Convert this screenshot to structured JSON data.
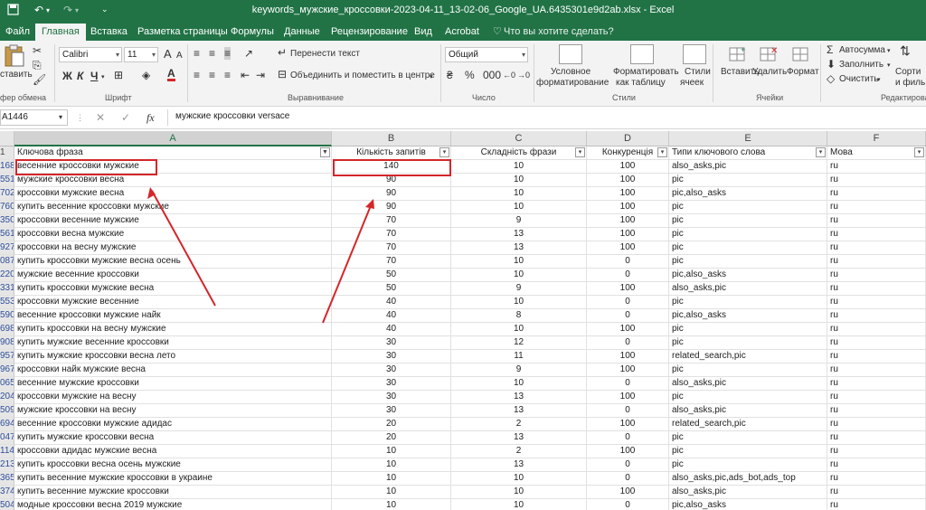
{
  "window": {
    "title": "keywords_мужские_кроссовки-2023-04-11_13-02-06_Google_UA.6435301e9d2ab.xlsx - Excel"
  },
  "tabs": [
    "Файл",
    "Главная",
    "Вставка",
    "Разметка страницы",
    "Формулы",
    "Данные",
    "Рецензирование",
    "Вид",
    "Acrobat",
    "Что вы хотите сделать?"
  ],
  "active_tab": "Главная",
  "ribbon": {
    "paste_label": "ставить",
    "clipboard_label": "фер обмена",
    "font_name": "Calibri",
    "font_size": "11",
    "bold": "Ж",
    "italic": "К",
    "underline": "Ч",
    "grow_font": "A",
    "shrink_font": "A",
    "font_color_letter": "A",
    "font_group_label": "Шрифт",
    "wrap_text": "Перенести текст",
    "merge_center": "Объединить и поместить в центре",
    "alignment_group_label": "Выравнивание",
    "number_format": "Общий",
    "number_group_label": "Число",
    "conditional_fmt_1": "Условное",
    "conditional_fmt_2": "форматирование",
    "format_table_1": "Форматировать",
    "format_table_2": "как таблицу",
    "cell_styles_1": "Стили",
    "cell_styles_2": "ячеек",
    "styles_group_label": "Стили",
    "insert": "Вставить",
    "delete": "Удалить",
    "format": "Формат",
    "cells_group_label": "Ячейки",
    "autosum": "Автосумма",
    "fill": "Заполнить",
    "clear": "Очистить",
    "sort_1": "Сорти",
    "sort_2": "и филь",
    "editing_group_label": "Редактирова"
  },
  "formula_bar": {
    "name_box": "A1446",
    "fx": "fx",
    "cancel": "✕",
    "enter": "✓",
    "content": "мужские кроссовки versace"
  },
  "columns": [
    {
      "letter": "A",
      "selected": true
    },
    {
      "letter": "B",
      "selected": false
    },
    {
      "letter": "C",
      "selected": false
    },
    {
      "letter": "D",
      "selected": false
    },
    {
      "letter": "E",
      "selected": false
    },
    {
      "letter": "F",
      "selected": false
    }
  ],
  "header_row": {
    "row_num": "1",
    "cells": [
      "Ключова фраза",
      "Кількість запитів",
      "Складність фрази",
      "Конкуренція",
      "Типи ключового слова",
      "Мова"
    ]
  },
  "rows": [
    {
      "n": "168",
      "a": "весенние кроссовки мужские",
      "b": "140",
      "c": "10",
      "d": "100",
      "e": "also_asks,pic",
      "f": "ru"
    },
    {
      "n": "551",
      "a": "мужские кроссовки весна",
      "b": "90",
      "c": "10",
      "d": "100",
      "e": "pic",
      "f": "ru"
    },
    {
      "n": "702",
      "a": "кроссовки мужские весна",
      "b": "90",
      "c": "10",
      "d": "100",
      "e": "pic,also_asks",
      "f": "ru"
    },
    {
      "n": "760",
      "a": "купить весенние кроссовки мужские",
      "b": "90",
      "c": "10",
      "d": "100",
      "e": "pic",
      "f": "ru"
    },
    {
      "n": "350",
      "a": "кроссовки весенние мужские",
      "b": "70",
      "c": "9",
      "d": "100",
      "e": "pic",
      "f": "ru"
    },
    {
      "n": "561",
      "a": "кроссовки весна мужские",
      "b": "70",
      "c": "13",
      "d": "100",
      "e": "pic",
      "f": "ru"
    },
    {
      "n": "927",
      "a": "кроссовки на весну мужские",
      "b": "70",
      "c": "13",
      "d": "100",
      "e": "pic",
      "f": "ru"
    },
    {
      "n": "087",
      "a": "купить кроссовки мужские весна осень",
      "b": "70",
      "c": "10",
      "d": "0",
      "e": "pic",
      "f": "ru"
    },
    {
      "n": "220",
      "a": "мужские весенние кроссовки",
      "b": "50",
      "c": "10",
      "d": "0",
      "e": "pic,also_asks",
      "f": "ru"
    },
    {
      "n": "331",
      "a": "купить кроссовки мужские весна",
      "b": "50",
      "c": "9",
      "d": "100",
      "e": "also_asks,pic",
      "f": "ru"
    },
    {
      "n": "553",
      "a": "кроссовки мужские весенние",
      "b": "40",
      "c": "10",
      "d": "0",
      "e": "pic",
      "f": "ru"
    },
    {
      "n": "590",
      "a": "весенние кроссовки мужские найк",
      "b": "40",
      "c": "8",
      "d": "0",
      "e": "pic,also_asks",
      "f": "ru"
    },
    {
      "n": "698",
      "a": "купить кроссовки на весну мужские",
      "b": "40",
      "c": "10",
      "d": "100",
      "e": "pic",
      "f": "ru"
    },
    {
      "n": "908",
      "a": "купить мужские весенние кроссовки",
      "b": "30",
      "c": "12",
      "d": "0",
      "e": "pic",
      "f": "ru"
    },
    {
      "n": "957",
      "a": "купить мужские кроссовки весна лето",
      "b": "30",
      "c": "11",
      "d": "100",
      "e": "related_search,pic",
      "f": "ru"
    },
    {
      "n": "967",
      "a": "кроссовки найк мужские весна",
      "b": "30",
      "c": "9",
      "d": "100",
      "e": "pic",
      "f": "ru"
    },
    {
      "n": "065",
      "a": "весенние мужские кроссовки",
      "b": "30",
      "c": "10",
      "d": "0",
      "e": "also_asks,pic",
      "f": "ru"
    },
    {
      "n": "204",
      "a": "кроссовки мужские на весну",
      "b": "30",
      "c": "13",
      "d": "100",
      "e": "pic",
      "f": "ru"
    },
    {
      "n": "509",
      "a": "мужские кроссовки на весну",
      "b": "30",
      "c": "13",
      "d": "0",
      "e": "also_asks,pic",
      "f": "ru"
    },
    {
      "n": "694",
      "a": "весенние кроссовки мужские адидас",
      "b": "20",
      "c": "2",
      "d": "100",
      "e": "related_search,pic",
      "f": "ru"
    },
    {
      "n": "047",
      "a": "купить мужские кроссовки весна",
      "b": "20",
      "c": "13",
      "d": "0",
      "e": "pic",
      "f": "ru"
    },
    {
      "n": "114",
      "a": "кроссовки адидас мужские весна",
      "b": "10",
      "c": "2",
      "d": "100",
      "e": "pic",
      "f": "ru"
    },
    {
      "n": "213",
      "a": "купить кроссовки весна осень мужские",
      "b": "10",
      "c": "13",
      "d": "0",
      "e": "pic",
      "f": "ru"
    },
    {
      "n": "365",
      "a": "купить весенние мужские кроссовки в украине",
      "b": "10",
      "c": "10",
      "d": "0",
      "e": "also_asks,pic,ads_bot,ads_top",
      "f": "ru"
    },
    {
      "n": "374",
      "a": "купить весенние мужские кроссовки",
      "b": "10",
      "c": "10",
      "d": "100",
      "e": "also_asks,pic",
      "f": "ru"
    },
    {
      "n": "504",
      "a": "модные кроссовки весна 2019 мужские",
      "b": "10",
      "c": "10",
      "d": "0",
      "e": "pic,also_asks",
      "f": "ru"
    }
  ],
  "colors": {
    "excel_green": "#217346",
    "highlight_red": "#d4262a",
    "row_number_blue": "#2f4f9a"
  }
}
